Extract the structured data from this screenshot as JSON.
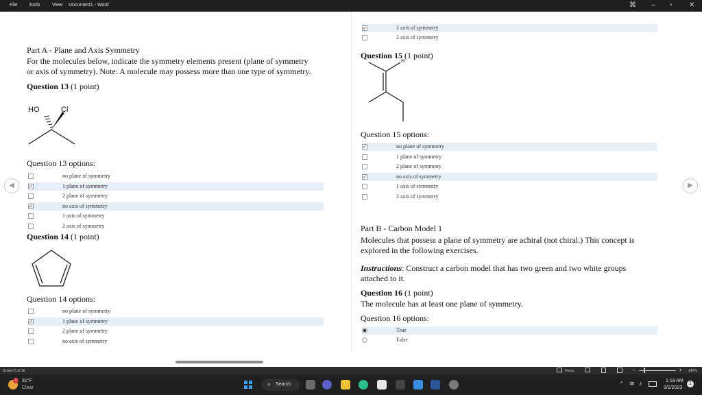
{
  "app": {
    "menu": [
      "File",
      "Tools",
      "View"
    ],
    "title": "Document1 - Word"
  },
  "left": {
    "partA_title": "Part A - Plane and Axis Symmetry",
    "partA_line1": "For the molecules below, indicate the symmetry elements present (plane of symmetry",
    "partA_line2": "or axis of symmetry).  Note: A molecule may possess more than one type of symmetry.",
    "q13_title": "Question 13",
    "q13_points": "(1 point)",
    "q13_mol_labels": {
      "ho": "HO",
      "cl": "Cl"
    },
    "q13_options_label": "Question 13 options:",
    "q13_options": [
      {
        "label": "no plane of symmetry",
        "checked": false,
        "highlight": false
      },
      {
        "label": "1 plane of symmetry",
        "checked": true,
        "highlight": true
      },
      {
        "label": "2 plane of symmetry",
        "checked": false,
        "highlight": false
      },
      {
        "label": "no axis of symmetry",
        "checked": true,
        "highlight": true
      },
      {
        "label": "1 axis of symmetry",
        "checked": false,
        "highlight": false
      },
      {
        "label": "2 axis of symmetry",
        "checked": false,
        "highlight": false
      }
    ],
    "q14_title": "Question 14",
    "q14_points": "(1 point)",
    "q14_options_label": "Question 14 options:",
    "q14_options": [
      {
        "label": "no plane of symmetry",
        "checked": false,
        "highlight": false
      },
      {
        "label": "1 plane of symmetry",
        "checked": true,
        "highlight": true
      },
      {
        "label": "2 plane of symmetry",
        "checked": false,
        "highlight": false
      },
      {
        "label": "no axis of symmetry",
        "checked": false,
        "highlight": false
      }
    ]
  },
  "right": {
    "top_options": [
      {
        "label": "1 axis of symmetry",
        "checked": true,
        "highlight": true
      },
      {
        "label": "2 axis of symmetry",
        "checked": false,
        "highlight": false
      }
    ],
    "q15_title": "Question 15",
    "q15_points": "(1 point)",
    "q15_mol_label": "H",
    "q15_options_label": "Question 15 options:",
    "q15_options": [
      {
        "label": "no plane of symmetry",
        "checked": true,
        "highlight": true
      },
      {
        "label": "1 plane of symmetry",
        "checked": false,
        "highlight": false
      },
      {
        "label": "2 plane of symmetry",
        "checked": false,
        "highlight": false
      },
      {
        "label": "no axis of symmetry",
        "checked": true,
        "highlight": true
      },
      {
        "label": "1 axis of symmetry",
        "checked": false,
        "highlight": false
      },
      {
        "label": "2 axis of symmetry",
        "checked": false,
        "highlight": false
      }
    ],
    "partB_title": "Part B - Carbon Model 1",
    "partB_line1": "Molecules that possess a plane of symmetry are achiral (not chiral.)  This concept is",
    "partB_line2": "explored in the following exercises.",
    "instr_label": "Instructions",
    "instr_line1": ":  Construct a carbon model that has two green and two white groups",
    "instr_line2": "attached to it.",
    "q16_title": "Question 16",
    "q16_points": "(1 point)",
    "q16_stmt": "The molecule has at least one plane of symmetry.",
    "q16_options_label": "Question 16 options:",
    "q16_options": [
      {
        "label": "True",
        "selected": true,
        "highlight": true
      },
      {
        "label": "False",
        "selected": false,
        "highlight": false
      }
    ]
  },
  "statusbar": {
    "screen": "Screen 5 of 16",
    "focus": "Focus",
    "zoom": "140%"
  },
  "taskbar": {
    "temp": "31°F",
    "weather": "Clear",
    "search": "Search",
    "time": "1:18 AM",
    "date": "3/1/2023",
    "notif_count": "1"
  },
  "colors": {
    "highlight": "#e6eef8",
    "titlebar": "#1f1f1f",
    "taskbar": "#202020"
  }
}
